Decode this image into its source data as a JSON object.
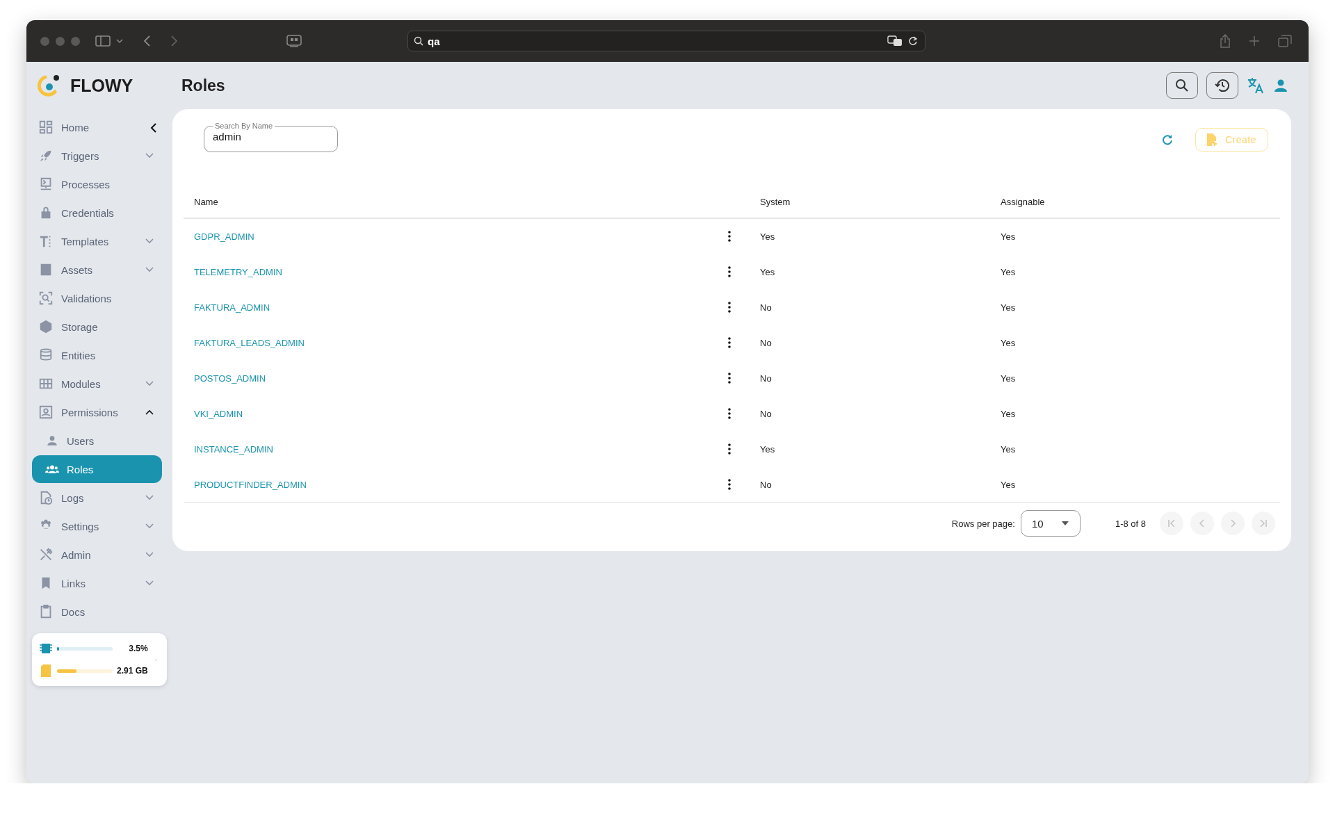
{
  "browser": {
    "url": "qa"
  },
  "app": {
    "name": "FLOWY"
  },
  "page": {
    "title": "Roles"
  },
  "sidebar": {
    "items": [
      {
        "label": "Home",
        "kind": "link",
        "selected": false
      },
      {
        "label": "Triggers",
        "kind": "group",
        "expanded": false,
        "selected": false
      },
      {
        "label": "Processes",
        "kind": "link",
        "selected": false
      },
      {
        "label": "Credentials",
        "kind": "link",
        "selected": false
      },
      {
        "label": "Templates",
        "kind": "group",
        "expanded": false,
        "selected": false
      },
      {
        "label": "Assets",
        "kind": "group",
        "expanded": false,
        "selected": false
      },
      {
        "label": "Validations",
        "kind": "link",
        "selected": false
      },
      {
        "label": "Storage",
        "kind": "link",
        "selected": false
      },
      {
        "label": "Entities",
        "kind": "link",
        "selected": false
      },
      {
        "label": "Modules",
        "kind": "group",
        "expanded": false,
        "selected": false
      },
      {
        "label": "Permissions",
        "kind": "group",
        "expanded": true,
        "selected": false,
        "children": [
          {
            "label": "Users",
            "selected": false
          },
          {
            "label": "Roles",
            "selected": true
          }
        ]
      },
      {
        "label": "Logs",
        "kind": "group",
        "expanded": false,
        "selected": false
      },
      {
        "label": "Settings",
        "kind": "group",
        "expanded": false,
        "selected": false
      },
      {
        "label": "Admin",
        "kind": "group",
        "expanded": false,
        "selected": false
      },
      {
        "label": "Links",
        "kind": "group",
        "expanded": false,
        "selected": false
      },
      {
        "label": "Docs",
        "kind": "link",
        "selected": false
      }
    ],
    "stats": [
      {
        "kind": "cpu",
        "reading": "3.5%",
        "level": 0.035
      },
      {
        "kind": "storage",
        "reading": "2.91 GB",
        "level": 0.35
      }
    ]
  },
  "search": {
    "label": "Search By Name",
    "value": "admin"
  },
  "create_button": {
    "label": "Create",
    "disabled": true
  },
  "table": {
    "columns": [
      "Name",
      "System",
      "Assignable"
    ],
    "rows": [
      {
        "name": "GDPR_ADMIN",
        "system": "Yes",
        "assignable": "Yes"
      },
      {
        "name": "TELEMETRY_ADMIN",
        "system": "Yes",
        "assignable": "Yes"
      },
      {
        "name": "FAKTURA_ADMIN",
        "system": "No",
        "assignable": "Yes"
      },
      {
        "name": "FAKTURA_LEADS_ADMIN",
        "system": "No",
        "assignable": "Yes"
      },
      {
        "name": "POSTOS_ADMIN",
        "system": "No",
        "assignable": "Yes"
      },
      {
        "name": "VKI_ADMIN",
        "system": "No",
        "assignable": "Yes"
      },
      {
        "name": "INSTANCE_ADMIN",
        "system": "Yes",
        "assignable": "Yes"
      },
      {
        "name": "PRODUCTFINDER_ADMIN",
        "system": "No",
        "assignable": "Yes"
      }
    ]
  },
  "pagination": {
    "rows_per_page_label": "Rows per page:",
    "rows_per_page": "10",
    "range": "1-8 of 8",
    "buttons": [
      {
        "kind": "first",
        "disabled": true
      },
      {
        "kind": "prev",
        "disabled": true
      },
      {
        "kind": "next",
        "disabled": true
      },
      {
        "kind": "last",
        "disabled": true
      }
    ]
  }
}
